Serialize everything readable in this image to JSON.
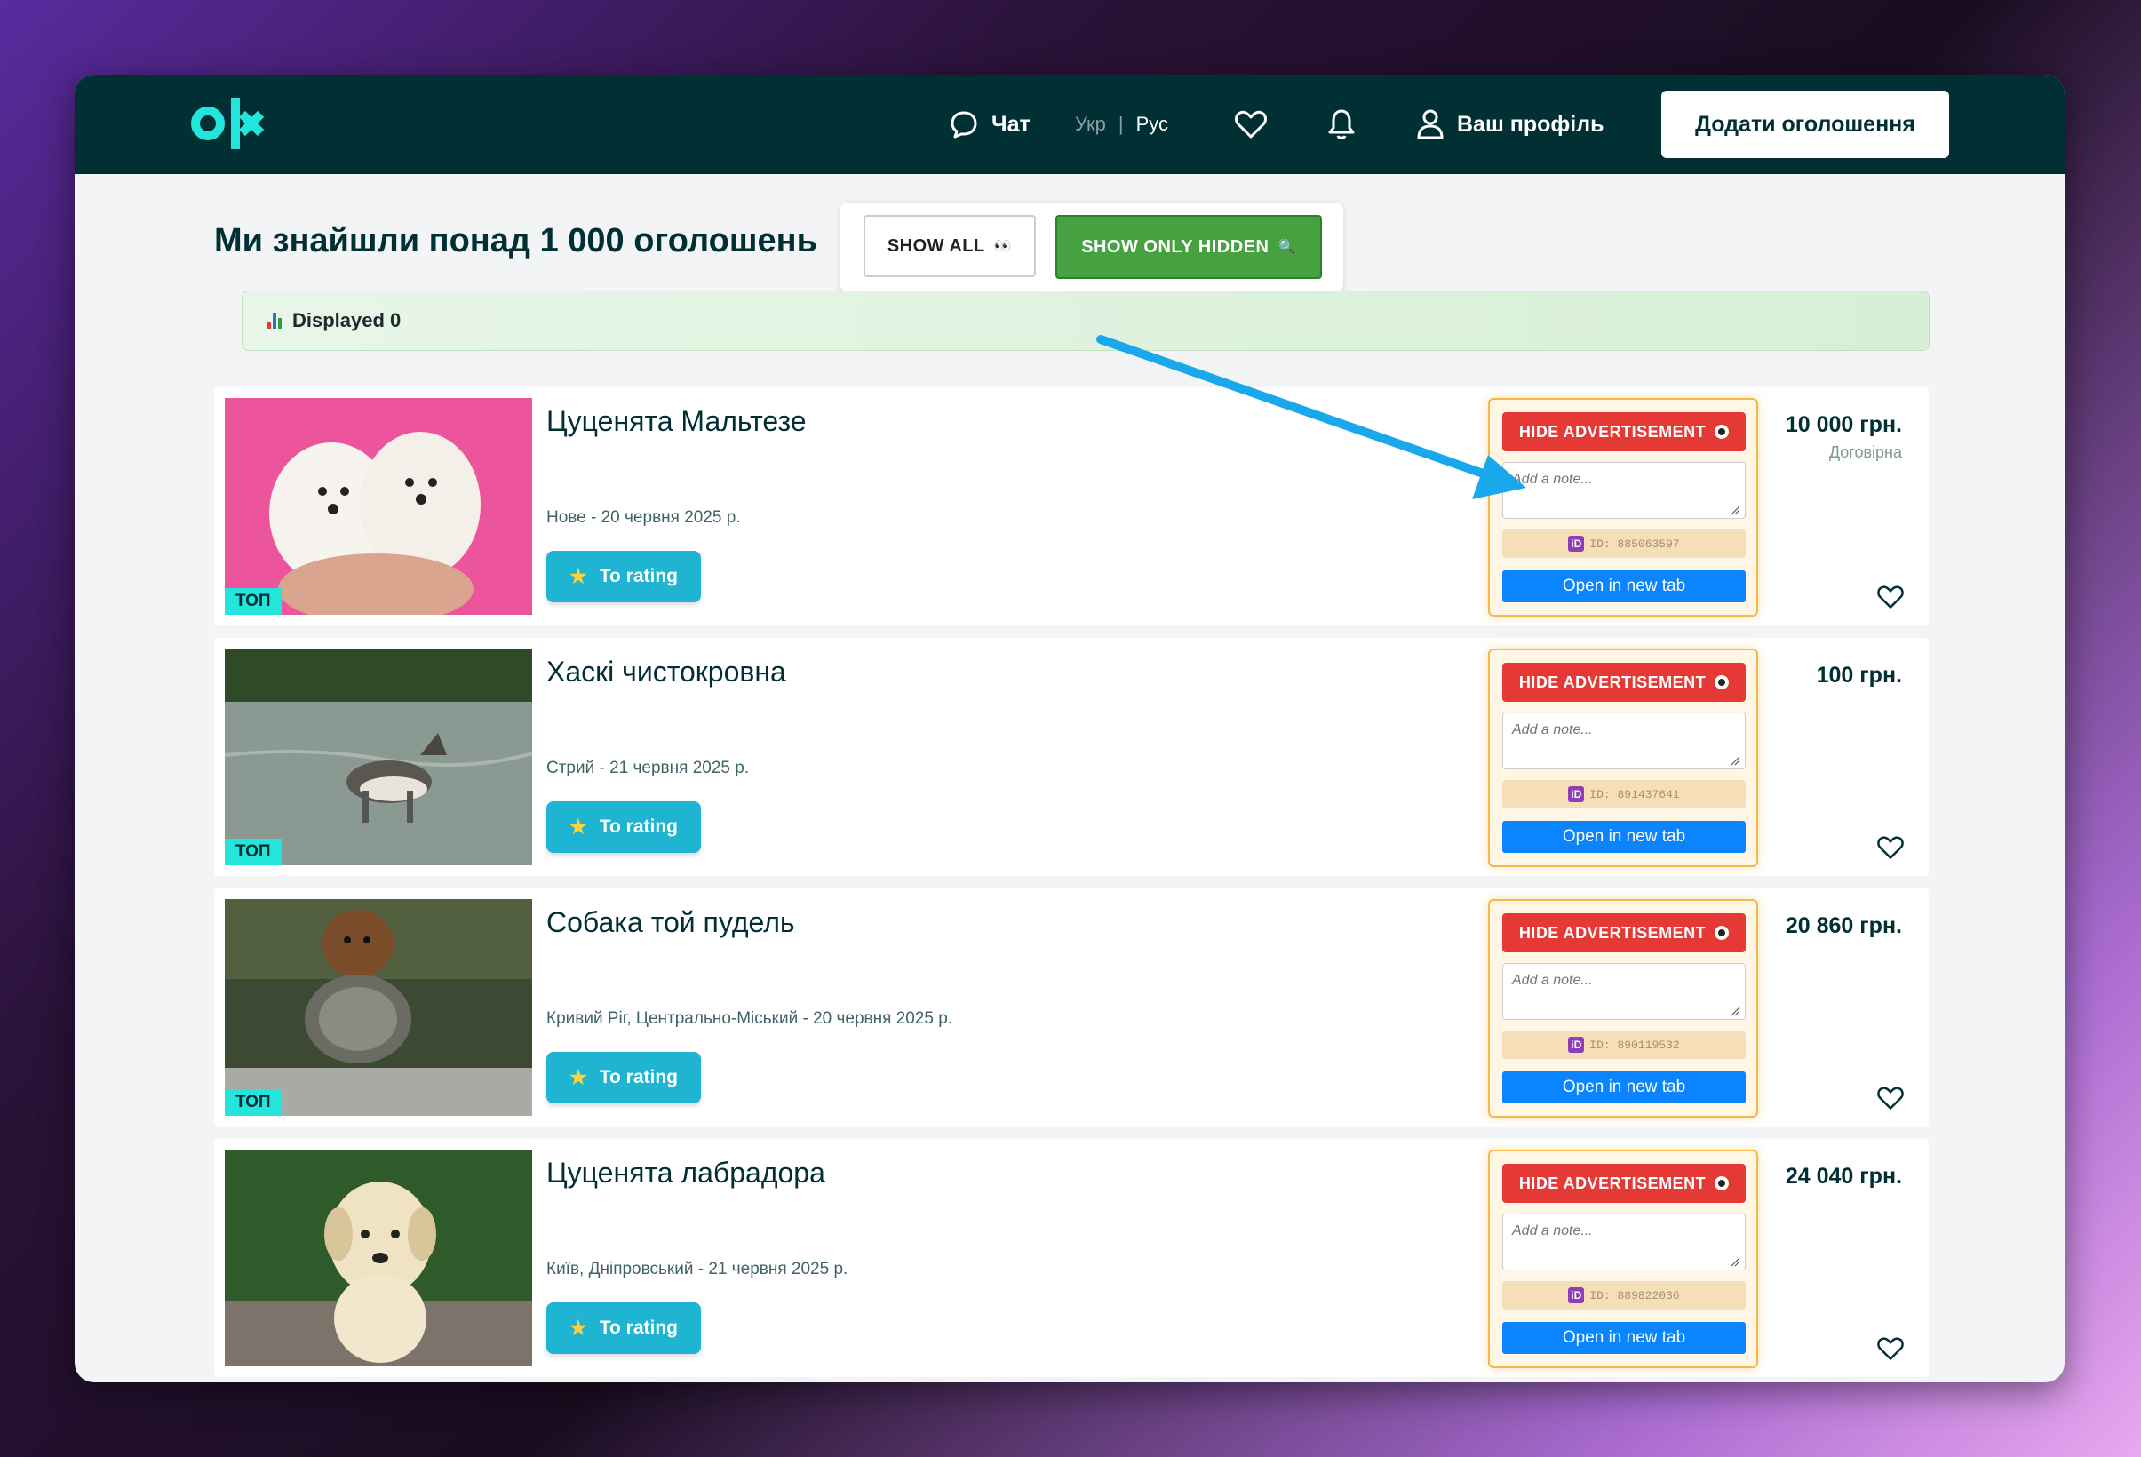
{
  "header": {
    "logo_text": "olx",
    "chat_label": "Чат",
    "lang_ukr": "Укр",
    "lang_separator": "|",
    "lang_rus": "Рус",
    "profile_label": "Ваш профіль",
    "add_ad_label": "Додати оголошення"
  },
  "main": {
    "title": "Ми знайшли понад 1 000 оголошень",
    "show_all_label": "SHOW ALL",
    "show_all_emoji": "👀",
    "show_hidden_label": "SHOW ONLY HIDDEN",
    "show_hidden_emoji": "🔍",
    "stats_label": "Displayed 0"
  },
  "listings": [
    {
      "title": "Цуценята Мальтезе",
      "location_date": "Нове - 20 червня 2025 р.",
      "price": "10 000 грн.",
      "negotiable": "Договірна",
      "badge": "ТОП",
      "ad_id": "ID: 885063597",
      "image": "maltese-puppies"
    },
    {
      "title": "Хаскі чистокровна",
      "location_date": "Стрий - 21 червня 2025 р.",
      "price": "100 грн.",
      "negotiable": "",
      "badge": "ТОП",
      "ad_id": "ID: 891437641",
      "image": "husky-in-water"
    },
    {
      "title": "Собака той пудель",
      "location_date": "Кривий Ріг, Центрально-Міський - 20 червня 2025 р.",
      "price": "20 860 грн.",
      "negotiable": "",
      "badge": "ТОП",
      "ad_id": "ID: 890119532",
      "image": "toy-poodle"
    },
    {
      "title": "Цуценята лабрадора",
      "location_date": "Київ, Дніпровський - 21 червня 2025 р.",
      "price": "24 040 грн.",
      "negotiable": "",
      "badge": "",
      "ad_id": "ID: 889822036",
      "image": "labrador-puppy"
    }
  ],
  "card_common": {
    "rating_label": "To rating",
    "hide_label": "HIDE ADVERTISEMENT",
    "note_placeholder": "Add a note...",
    "id_icon": "iD",
    "open_tab_label": "Open in new tab"
  },
  "colors": {
    "header_bg": "#002f34",
    "accent_teal": "#23e5db",
    "rating_btn": "#1fb4d2",
    "hide_btn": "#e53935",
    "open_btn": "#0a84ff",
    "show_hidden_btn": "#46a140",
    "annotation_arrow": "#1aa8ec"
  }
}
